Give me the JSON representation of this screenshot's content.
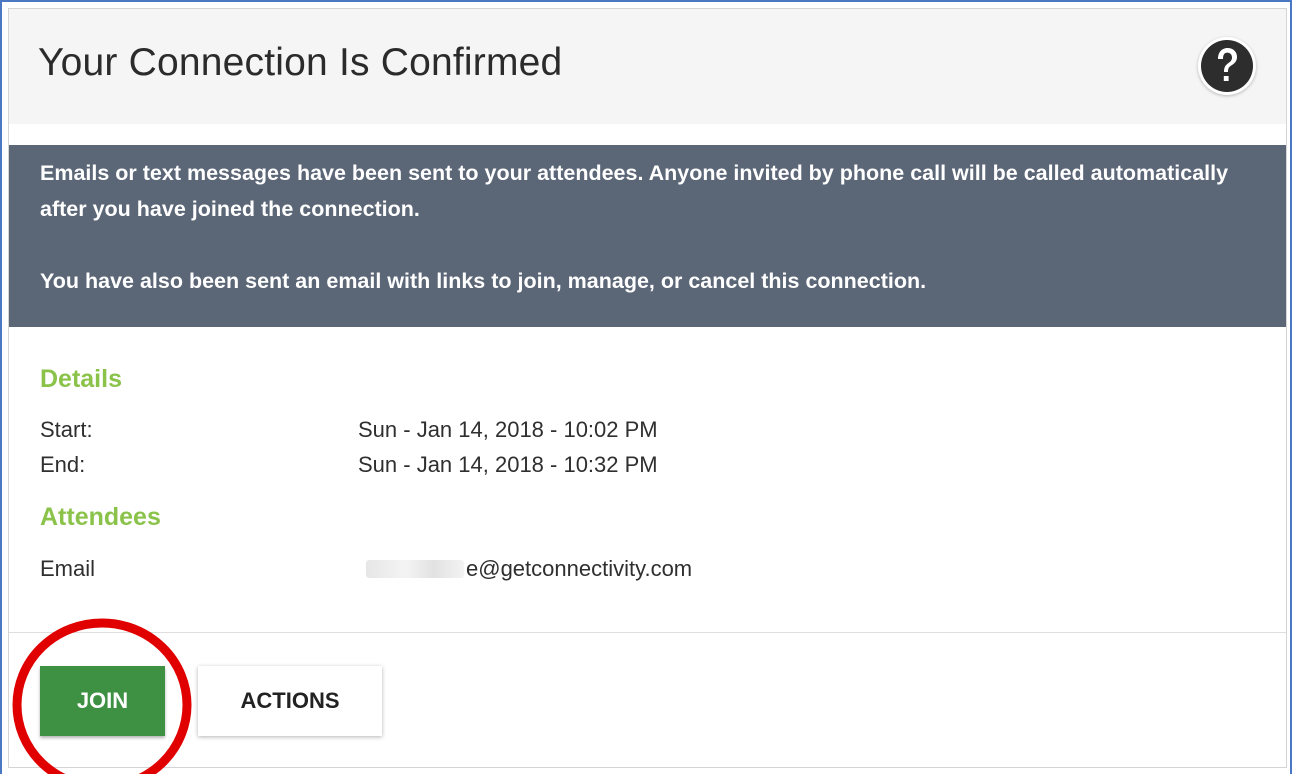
{
  "header": {
    "title": "Your Connection Is Confirmed",
    "help_icon": "question-mark-icon"
  },
  "banner": {
    "background": "#5b6677",
    "message_sent": "Emails or text messages have been sent to your attendees. Anyone invited by phone call will be called automatically after you have joined the connection.",
    "message_email": "You have also been sent an email with links to join, manage, or cancel this connection."
  },
  "details": {
    "heading": "Details",
    "start_label": "Start:",
    "start_value": "Sun - Jan 14, 2018 - 10:02 PM",
    "end_label": "End:",
    "end_value": "Sun - Jan 14, 2018 - 10:32 PM"
  },
  "attendees": {
    "heading": "Attendees",
    "rows": [
      {
        "type_label": "Email",
        "value_visible": "e@getconnectivity.com"
      }
    ]
  },
  "actions": {
    "join_label": "JOIN",
    "actions_label": "ACTIONS"
  },
  "colors": {
    "accent_green": "#8bc34a",
    "join_button": "#3e9142",
    "annotation_circle": "#e00000"
  }
}
